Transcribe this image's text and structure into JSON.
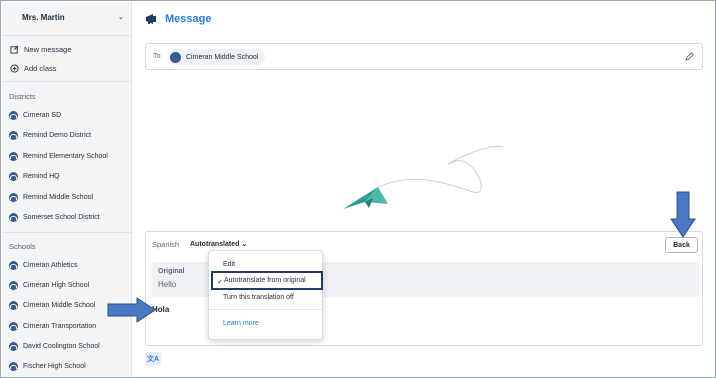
{
  "sidebar": {
    "user_name": "Mrs. Martin",
    "actions": [
      {
        "label": "New message",
        "icon": "compose-icon"
      },
      {
        "label": "Add class",
        "icon": "plus-circle-icon"
      }
    ],
    "districts_heading": "Districts",
    "districts": [
      "Cimeran SD",
      "Remind Demo District",
      "Remind Elementary School",
      "Remind HQ",
      "Remind Middle School",
      "Somerset School District"
    ],
    "schools_heading": "Schools",
    "schools": [
      "Cimeran Athletics",
      "Cimeran High School",
      "Cimeran Middle School",
      "Cimeran Transportation",
      "David Coolington School",
      "Fischer High School"
    ]
  },
  "header": {
    "title": "Message",
    "icon": "megaphone-icon"
  },
  "to_field": {
    "label": "To:",
    "recipient": "Cimeran Middle School"
  },
  "translation": {
    "language": "Spanish",
    "mode": "Autotranslated",
    "original_label": "Original",
    "original_text": "Hello",
    "translated_text": "Hola",
    "back_label": "Back"
  },
  "menu": {
    "items": [
      "Edit",
      "Autotranslate from original",
      "Turn this translation off"
    ],
    "selected": "Autotranslate from original",
    "learn_more": "Learn more"
  },
  "colors": {
    "accent": "#2b7bd0",
    "annotation_arrow": "#4a78c2",
    "plane": "#2a9d8f"
  }
}
